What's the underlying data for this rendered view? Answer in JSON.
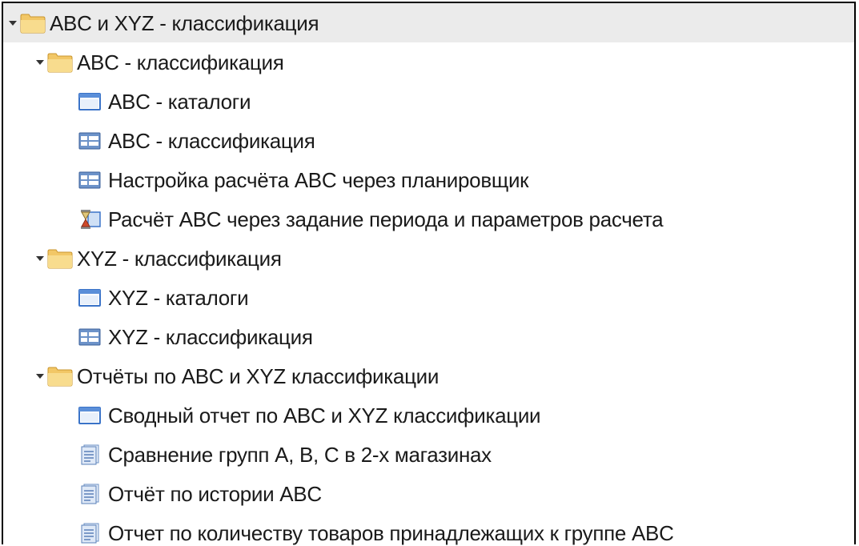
{
  "tree": {
    "root": {
      "label": "ABC и  XYZ - классификация",
      "icon": "folder-icon",
      "expanded": true,
      "selected": true
    },
    "groups": [
      {
        "label": "ABC - классификация",
        "icon": "folder-icon",
        "expanded": true,
        "items": [
          {
            "label": "ABC - каталоги",
            "icon": "window-icon"
          },
          {
            "label": "ABC - классификация",
            "icon": "form-icon"
          },
          {
            "label": "Настройка расчёта ABC через планировщик",
            "icon": "form-icon"
          },
          {
            "label": "Расчёт ABC через задание периода и параметров расчета",
            "icon": "hourglass-icon"
          }
        ]
      },
      {
        "label": "XYZ - классификация",
        "icon": "folder-icon",
        "expanded": true,
        "items": [
          {
            "label": "XYZ - каталоги",
            "icon": "window-icon"
          },
          {
            "label": "XYZ - классификация",
            "icon": "form-icon"
          }
        ]
      },
      {
        "label": "Отчёты по ABC и XYZ классификации",
        "icon": "folder-icon",
        "expanded": true,
        "items": [
          {
            "label": "Сводный отчет по ABC и XYZ классификации",
            "icon": "window-icon"
          },
          {
            "label": "Сравнение групп A, B, C в 2-х магазинах",
            "icon": "report-icon"
          },
          {
            "label": "Отчёт по истории ABC",
            "icon": "report-icon"
          },
          {
            "label": "Отчет по количеству товаров принадлежащих к группе ABC",
            "icon": "report-icon"
          }
        ]
      }
    ]
  },
  "colors": {
    "selected_row": "#ebebeb",
    "border": "#000000",
    "folder": "#f3d27a",
    "window_frame": "#3a73c8"
  }
}
